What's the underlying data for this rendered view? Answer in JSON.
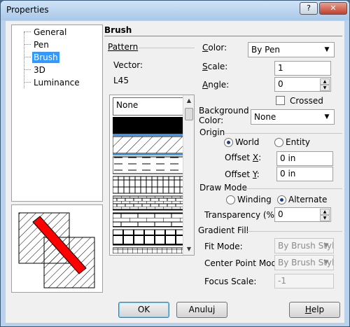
{
  "window": {
    "title": "Properties",
    "help_glyph": "?",
    "close_glyph": "✕"
  },
  "tree": {
    "items": [
      "General",
      "Pen",
      "Brush",
      "3D",
      "Luminance"
    ],
    "selected": "Brush"
  },
  "section": {
    "title": "Brush"
  },
  "pattern": {
    "label": "Pattern",
    "vector_label": "Vector:",
    "vector_value": "L45",
    "none_label": "None",
    "items": [
      "solid",
      "diagonal",
      "dashes",
      "brick-vertical",
      "brick-small",
      "brick-large",
      "brick-wide",
      "brick-fine"
    ],
    "selected": "diagonal"
  },
  "color": {
    "label": "Color:",
    "value": "By Pen"
  },
  "scale": {
    "label": "Scale:",
    "value": "1"
  },
  "angle": {
    "label": "Angle:",
    "value": "0"
  },
  "crossed": {
    "label": "Crossed",
    "checked": false
  },
  "background_color": {
    "label_line1": "Background",
    "label_line2": "Color:",
    "value": "None"
  },
  "origin": {
    "label": "Origin",
    "world": "World",
    "entity": "Entity",
    "selected": "World",
    "offset_x_label": "Offset X:",
    "offset_x_value": "0 in",
    "offset_y_label": "Offset Y:",
    "offset_y_value": "0 in"
  },
  "draw_mode": {
    "label": "Draw Mode",
    "winding": "Winding",
    "alternate": "Alternate",
    "selected": "Alternate"
  },
  "transparency": {
    "label": "Transparency (%):",
    "value": "0"
  },
  "gradient": {
    "label": "Gradient Fill",
    "fit_mode_label": "Fit Mode:",
    "fit_mode_value": "By Brush Styl",
    "center_label": "Center Point Mode:",
    "center_value": "By Brush Styl",
    "focus_label": "Focus Scale:",
    "focus_value": "-1"
  },
  "buttons": {
    "ok": "OK",
    "cancel": "Anuluj",
    "help": "Help"
  },
  "colors": {
    "preview_fill": "#ff0000",
    "selection": "#3399ff"
  }
}
